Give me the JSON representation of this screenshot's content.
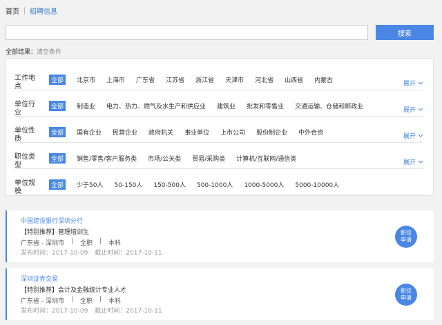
{
  "breadcrumb": {
    "home": "首页",
    "current": "招聘信息"
  },
  "search": {
    "value": "",
    "placeholder": "",
    "button_label": "搜索"
  },
  "results": {
    "label": "全部结果：",
    "clear": "清空条件"
  },
  "filters": {
    "expand_label": "展开",
    "rows": [
      {
        "label": "工作地点",
        "options": [
          "全部",
          "北京市",
          "上海市",
          "广东省",
          "江苏省",
          "浙江省",
          "天津市",
          "河北省",
          "山西省",
          "内蒙古"
        ],
        "expandable": true
      },
      {
        "label": "单位行业",
        "options": [
          "全部",
          "制造业",
          "电力、热力、燃气及水生产和供应业",
          "建筑业",
          "批发和零售业",
          "交通运输、仓储和邮政业"
        ],
        "expandable": true
      },
      {
        "label": "单位性质",
        "options": [
          "全部",
          "国有企业",
          "民营企业",
          "政府机关",
          "事业单位",
          "上市公司",
          "股份制企业",
          "中外合资"
        ],
        "expandable": true
      },
      {
        "label": "职位类型",
        "options": [
          "全部",
          "销售/零售/客户服务类",
          "市场/公关类",
          "贸易/采购类",
          "计算机/互联网/通信类"
        ],
        "expandable": true
      },
      {
        "label": "单位规模",
        "options": [
          "全部",
          "少于50人",
          "50-150人",
          "150-500人",
          "500-1000人",
          "1000-5000人",
          "5000-10000人"
        ],
        "expandable": false
      }
    ]
  },
  "jobs": [
    {
      "company": "中国建设银行深圳分行",
      "title": "【特别推荐】管理培训生",
      "location": "广东省 - 深圳市",
      "type": "全职",
      "education": "本科",
      "publish": "发布时间：2017-10-09",
      "deadline": "截止时间：2017-10-11",
      "apply_line1": "职位",
      "apply_line2": "申请"
    },
    {
      "company": "深圳证券交易",
      "title": "【特别推荐】会计及金融统计专业人才",
      "location": "广东省 - 深圳市",
      "type": "全职",
      "education": "本科",
      "publish": "发布时间：2017-10-09",
      "deadline": "截止时间：2017-10-11",
      "apply_line1": "职位",
      "apply_line2": "申请"
    }
  ],
  "colors": {
    "accent": "#4a87e4",
    "background": "#f2f2f2"
  },
  "icons": {
    "expand": "chevron-down-icon"
  }
}
